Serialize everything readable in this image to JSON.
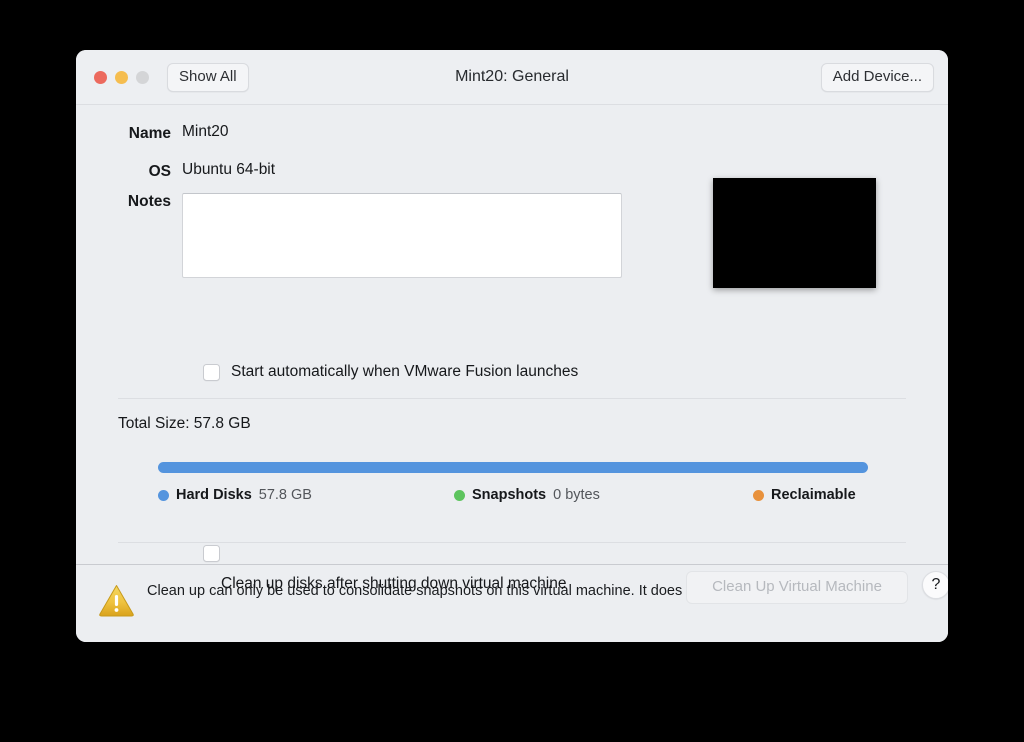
{
  "window": {
    "title": "Mint20: General",
    "traffic_lights": [
      {
        "name": "close",
        "color": "#EC6A5E"
      },
      {
        "name": "minimize",
        "color": "#F5BD4F"
      },
      {
        "name": "zoom",
        "color": "#D4D5D7"
      }
    ],
    "show_all_label": "Show All",
    "add_device_label": "Add Device..."
  },
  "general": {
    "name_label": "Name",
    "name_value": "Mint20",
    "os_label": "OS",
    "os_value": "Ubuntu 64-bit",
    "notes_label": "Notes",
    "notes_value": "",
    "notes_placeholder": "",
    "autostart_label": "Start automatically when VMware Fusion launches",
    "autostart_checked": false
  },
  "storage": {
    "total_size_label": "Total Size: 57.8 GB",
    "legend": [
      {
        "name": "Hard Disks",
        "value": "57.8 GB",
        "color": "#5494DE"
      },
      {
        "name": "Snapshots",
        "value": "0 bytes",
        "color": "#5DC45E"
      },
      {
        "name": "Reclaimable",
        "value": "",
        "color": "#E8913C"
      }
    ]
  },
  "chart_data": {
    "type": "bar",
    "title": "Total Size: 57.8 GB",
    "categories": [
      "Hard Disks",
      "Snapshots",
      "Reclaimable"
    ],
    "values": [
      57.8,
      0,
      0
    ],
    "units": "GB",
    "colors": [
      "#5494DE",
      "#5DC45E",
      "#E8913C"
    ],
    "total": 57.8,
    "legend_position": "below"
  },
  "cleanup": {
    "checkbox_checked": false,
    "label": "Clean up disks after shutting down virtual machine",
    "button_label": "Clean Up Virtual Machine",
    "button_disabled": true,
    "help_label": "?"
  },
  "footer": {
    "warning_text": "Clean up can only be used to consolidate snapshots on this virtual machine. It does not apply to the virtual disks."
  }
}
